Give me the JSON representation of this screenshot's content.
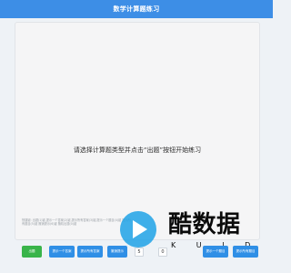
{
  "header": {
    "title": "数学计算题练习"
  },
  "main": {
    "prompt": "请选择计算题类型并点击“出题”按钮开始练习",
    "footer_hint": "快捷键: 出题(1)键,提示一个答案(2)键,提示所有答案(3)键,提示一个题目(4)键 提示所有题目(5)键 撤销提示(6)键 随机出题(0)键"
  },
  "toolbar": {
    "buttons": [
      {
        "label": "出题",
        "color": "#39b44a"
      },
      {
        "label": "提示一个答案",
        "color": "#2f8fe6"
      },
      {
        "label": "提示所有答案",
        "color": "#2f8fe6"
      },
      {
        "label": "撤销提示",
        "color": "#2f8fe6"
      },
      {
        "label": "提示一个题目",
        "color": "#2f8fe6"
      },
      {
        "label": "提示所有题目",
        "color": "#2f8fe6"
      }
    ],
    "count_inputs": [
      "5",
      "0"
    ]
  },
  "watermark": {
    "text": "酷数据",
    "subtext": "K U I D"
  },
  "colors": {
    "accent": "#3d8ee6",
    "success": "#39b44a",
    "background": "#eef2f6"
  }
}
